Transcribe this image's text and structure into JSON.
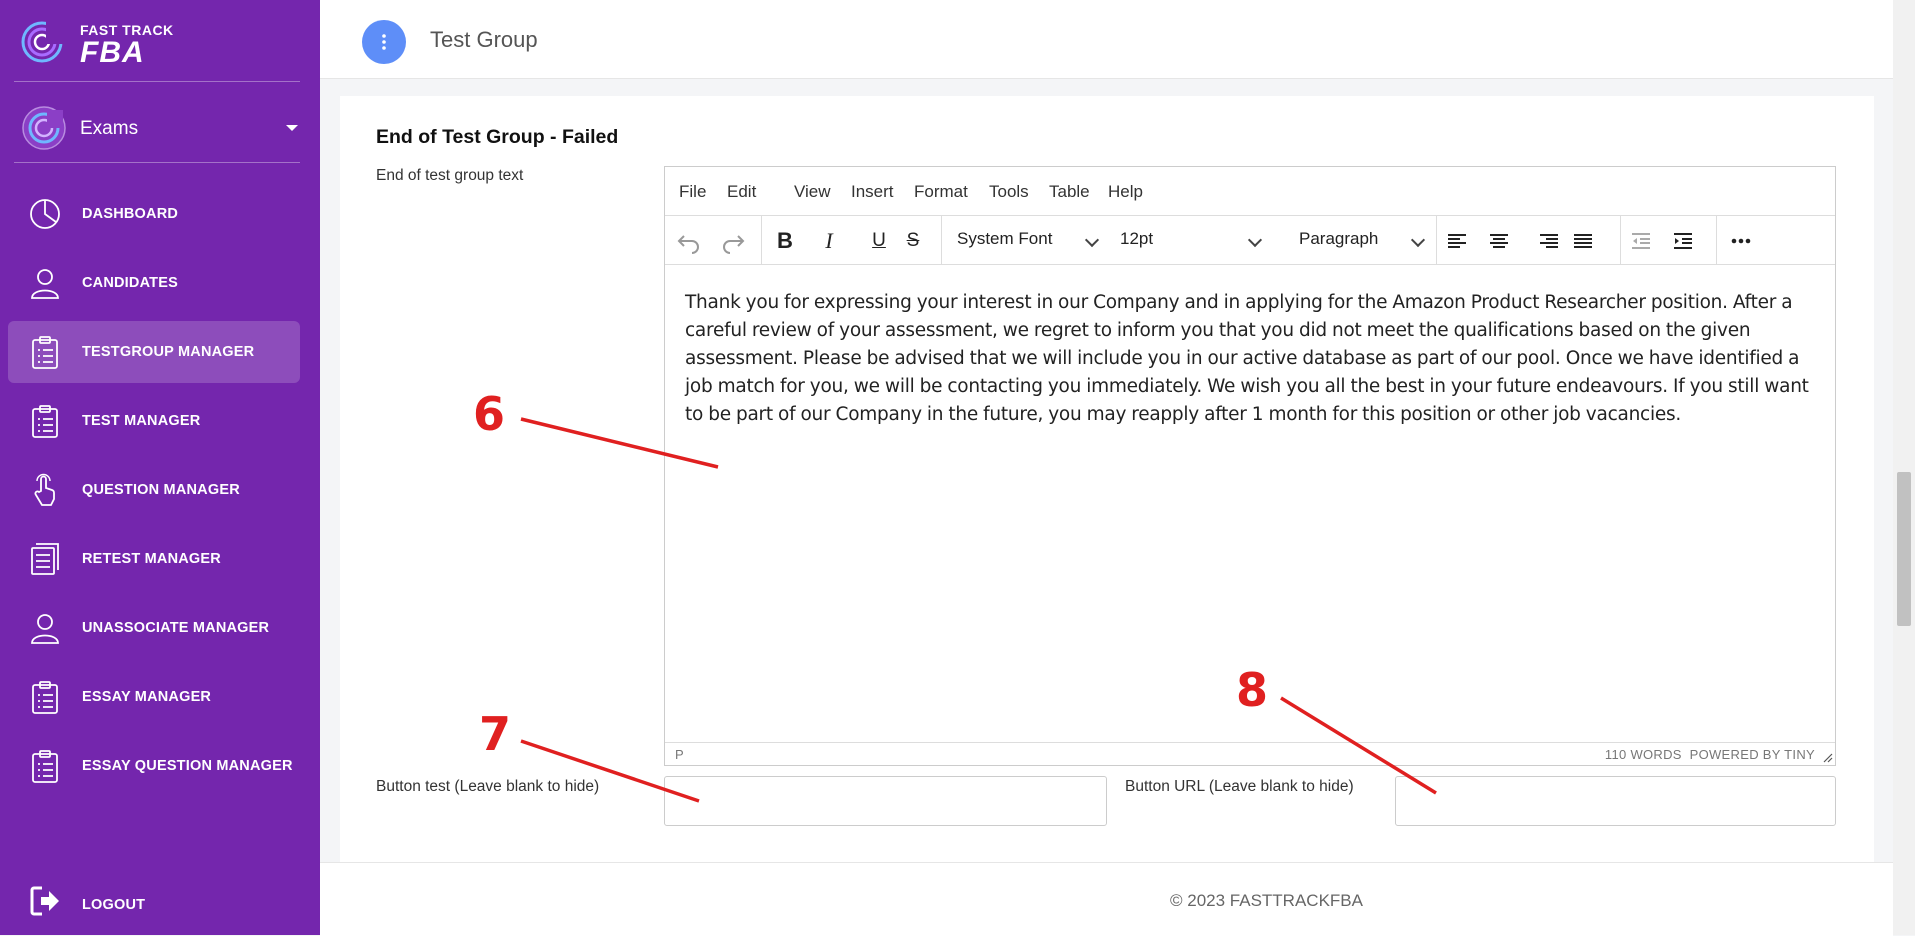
{
  "brand": {
    "line1": "FAST TRACK",
    "line2": "FBA"
  },
  "sidebar": {
    "exams_label": "Exams",
    "items": [
      {
        "label": "DASHBOARD",
        "icon": "pie-chart-icon"
      },
      {
        "label": "CANDIDATES",
        "icon": "user-icon"
      },
      {
        "label": "TESTGROUP MANAGER",
        "icon": "clipboard-icon",
        "active": true
      },
      {
        "label": "TEST MANAGER",
        "icon": "clipboard-icon"
      },
      {
        "label": "QUESTION MANAGER",
        "icon": "pointer-hand-icon"
      },
      {
        "label": "RETEST MANAGER",
        "icon": "document-list-icon"
      },
      {
        "label": "UNASSOCIATE MANAGER",
        "icon": "user-icon"
      },
      {
        "label": "ESSAY MANAGER",
        "icon": "clipboard-icon"
      },
      {
        "label": "ESSAY QUESTION MANAGER",
        "icon": "clipboard-icon"
      }
    ],
    "logout_label": "LOGOUT"
  },
  "header": {
    "title": "Test Group"
  },
  "section": {
    "title": "End of Test Group - Failed",
    "text_label": "End of test group text",
    "button_text_label": "Button test (Leave blank to hide)",
    "button_url_label": "Button URL (Leave blank to hide)"
  },
  "editor": {
    "menu": [
      "File",
      "Edit",
      "View",
      "Insert",
      "Format",
      "Tools",
      "Table",
      "Help"
    ],
    "font_family": "System Font",
    "font_size": "12pt",
    "block_format": "Paragraph",
    "content": "Thank you for expressing your interest in our Company and in applying for the Amazon Product Researcher position. After a careful review of your assessment, we regret to inform you that you did not meet the qualifications based on the given assessment. Please be advised that we will include you in our active database as part of our pool. Once we have identified a job match for you, we will be contacting you immediately. We wish you all the best in your future endeavours. If you still want to be part of our Company in the future, you may reapply after 1 month for this position or other job vacancies.",
    "status_path": "P",
    "word_count": "110 WORDS",
    "powered_by": "POWERED BY TINY"
  },
  "footer": {
    "copyright": "© 2023 FASTTRACKFBA"
  },
  "annotations": [
    "6",
    "7",
    "8"
  ],
  "colors": {
    "sidebar": "#7426ad",
    "accent": "#5e8ef8",
    "annotation": "#e02020"
  }
}
